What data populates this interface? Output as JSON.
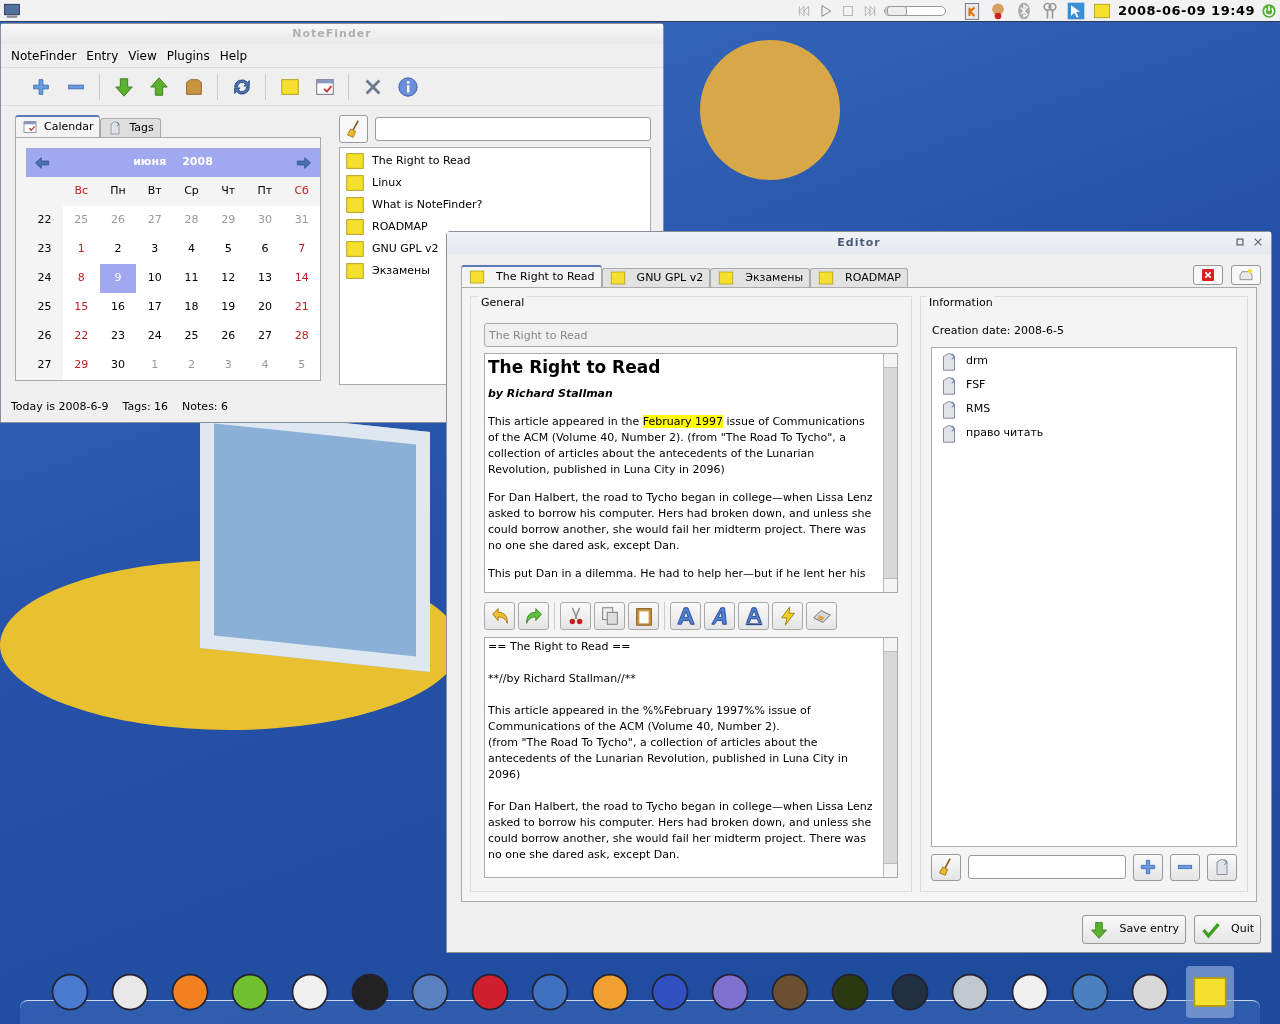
{
  "top_panel": {
    "seek_slider": {
      "level": 0.04
    },
    "clock": "2008-06-09 19:49"
  },
  "notefinder": {
    "title": "NoteFinder",
    "menu": [
      "NoteFinder",
      "Entry",
      "View",
      "Plugins",
      "Help"
    ],
    "tabs": [
      {
        "label": "Calendar",
        "selected": true
      },
      {
        "label": "Tags",
        "selected": false
      }
    ],
    "calendar": {
      "month": "июня",
      "year": "2008",
      "weekdays": [
        {
          "label": "Вс",
          "weekend": true
        },
        {
          "label": "Пн",
          "weekend": false
        },
        {
          "label": "Вт",
          "weekend": false
        },
        {
          "label": "Ср",
          "weekend": false
        },
        {
          "label": "Чт",
          "weekend": false
        },
        {
          "label": "Пт",
          "weekend": false
        },
        {
          "label": "Сб",
          "weekend": true
        }
      ],
      "weeks": [
        {
          "number": "22",
          "days": [
            {
              "label": "25",
              "other": true,
              "selected": false
            },
            {
              "label": "26",
              "other": true,
              "selected": false
            },
            {
              "label": "27",
              "other": true,
              "selected": false
            },
            {
              "label": "28",
              "other": true,
              "selected": false
            },
            {
              "label": "29",
              "other": true,
              "selected": false
            },
            {
              "label": "30",
              "other": true,
              "selected": false
            },
            {
              "label": "31",
              "other": true,
              "selected": false
            }
          ]
        },
        {
          "number": "23",
          "days": [
            {
              "label": "1",
              "other": false,
              "selected": false
            },
            {
              "label": "2",
              "other": false,
              "selected": false
            },
            {
              "label": "3",
              "other": false,
              "selected": false
            },
            {
              "label": "4",
              "other": false,
              "selected": false
            },
            {
              "label": "5",
              "other": false,
              "selected": false
            },
            {
              "label": "6",
              "other": false,
              "selected": false
            },
            {
              "label": "7",
              "other": false,
              "selected": false
            }
          ]
        },
        {
          "number": "24",
          "days": [
            {
              "label": "8",
              "other": false,
              "selected": false
            },
            {
              "label": "9",
              "other": false,
              "selected": true
            },
            {
              "label": "10",
              "other": false,
              "selected": false
            },
            {
              "label": "11",
              "other": false,
              "selected": false
            },
            {
              "label": "12",
              "other": false,
              "selected": false
            },
            {
              "label": "13",
              "other": false,
              "selected": false
            },
            {
              "label": "14",
              "other": false,
              "selected": false
            }
          ]
        },
        {
          "number": "25",
          "days": [
            {
              "label": "15",
              "other": false,
              "selected": false
            },
            {
              "label": "16",
              "other": false,
              "selected": false
            },
            {
              "label": "17",
              "other": false,
              "selected": false
            },
            {
              "label": "18",
              "other": false,
              "selected": false
            },
            {
              "label": "19",
              "other": false,
              "selected": false
            },
            {
              "label": "20",
              "other": false,
              "selected": false
            },
            {
              "label": "21",
              "other": false,
              "selected": false
            }
          ]
        },
        {
          "number": "26",
          "days": [
            {
              "label": "22",
              "other": false,
              "selected": false
            },
            {
              "label": "23",
              "other": false,
              "selected": false
            },
            {
              "label": "24",
              "other": false,
              "selected": false
            },
            {
              "label": "25",
              "other": false,
              "selected": false
            },
            {
              "label": "26",
              "other": false,
              "selected": false
            },
            {
              "label": "27",
              "other": false,
              "selected": false
            },
            {
              "label": "28",
              "other": false,
              "selected": false
            }
          ]
        },
        {
          "number": "27",
          "days": [
            {
              "label": "29",
              "other": false,
              "selected": false
            },
            {
              "label": "30",
              "other": false,
              "selected": false
            },
            {
              "label": "1",
              "other": true,
              "selected": false
            },
            {
              "label": "2",
              "other": true,
              "selected": false
            },
            {
              "label": "3",
              "other": true,
              "selected": false
            },
            {
              "label": "4",
              "other": true,
              "selected": false
            },
            {
              "label": "5",
              "other": true,
              "selected": false
            }
          ]
        }
      ]
    },
    "notes": [
      "The Right to Read",
      "Linux",
      "What is NoteFinder?",
      "ROADMAP",
      "GNU GPL v2",
      "Экзамены"
    ],
    "status": [
      "Today is 2008-6-9",
      "Tags: 16",
      "Notes: 6"
    ]
  },
  "editor": {
    "title": "Editor",
    "tabs": [
      {
        "label": "The Right to Read",
        "selected": true
      },
      {
        "label": "GNU GPL v2",
        "selected": false
      },
      {
        "label": "Экзамены",
        "selected": false
      },
      {
        "label": "ROADMAP",
        "selected": false
      }
    ],
    "general": {
      "legend": "General",
      "title_field": "The Right to Read",
      "preview": {
        "heading": "The Right to Read",
        "byline": "by Richard Stallman",
        "paragraphs": [
          [
            {
              "text": "This article appeared in the ",
              "highlight": false
            },
            {
              "text": "February 1997",
              "highlight": true
            },
            {
              "text": " issue of Communications of the ACM (Volume 40, Number 2). (from \"The Road To Tycho\", a collection of articles about the antecedents of the Lunarian Revolution, published in Luna City in 2096)",
              "highlight": false
            }
          ],
          [
            {
              "text": "For Dan Halbert, the road to Tycho began in college—when Lissa Lenz asked to borrow his computer. Hers had broken down, and unless she could borrow another, she would fail her midterm project. There was no one she dared ask, except Dan.",
              "highlight": false
            }
          ],
          [
            {
              "text": "This put Dan in a dilemma. He had to help her—but if he lent her his",
              "highlight": false
            }
          ]
        ]
      },
      "source": [
        [
          "== The Right to Read =="
        ],
        [
          "**//by Richard Stallman//**"
        ],
        [
          "This article appeared in the %%February 1997%% issue of Communications of the ACM (Volume 40, Number 2).",
          "(from \"The Road To Tycho\", a collection of articles about the antecedents of the Lunarian Revolution, published in Luna City in 2096)"
        ],
        [
          "For Dan Halbert, the road to Tycho began in college—when Lissa Lenz asked to borrow his computer. Hers had broken down, and unless she could borrow another, she would fail her midterm project. There was no one she dared ask, except Dan."
        ]
      ]
    },
    "information": {
      "legend": "Information",
      "creation_date": "Creation date: 2008-6-5",
      "tags": [
        "drm",
        "FSF",
        "RMS",
        "право читать"
      ]
    },
    "buttons": [
      "Save entry",
      "Quit"
    ]
  },
  "dock": [
    {
      "selected": false
    },
    {
      "selected": false
    },
    {
      "selected": false
    },
    {
      "selected": false
    },
    {
      "selected": false
    },
    {
      "selected": false
    },
    {
      "selected": false
    },
    {
      "selected": false
    },
    {
      "selected": false
    },
    {
      "selected": false
    },
    {
      "selected": false
    },
    {
      "selected": false
    },
    {
      "selected": false
    },
    {
      "selected": false
    },
    {
      "selected": false
    },
    {
      "selected": false
    },
    {
      "selected": false
    },
    {
      "selected": false
    },
    {
      "selected": false
    },
    {
      "selected": true
    }
  ]
}
